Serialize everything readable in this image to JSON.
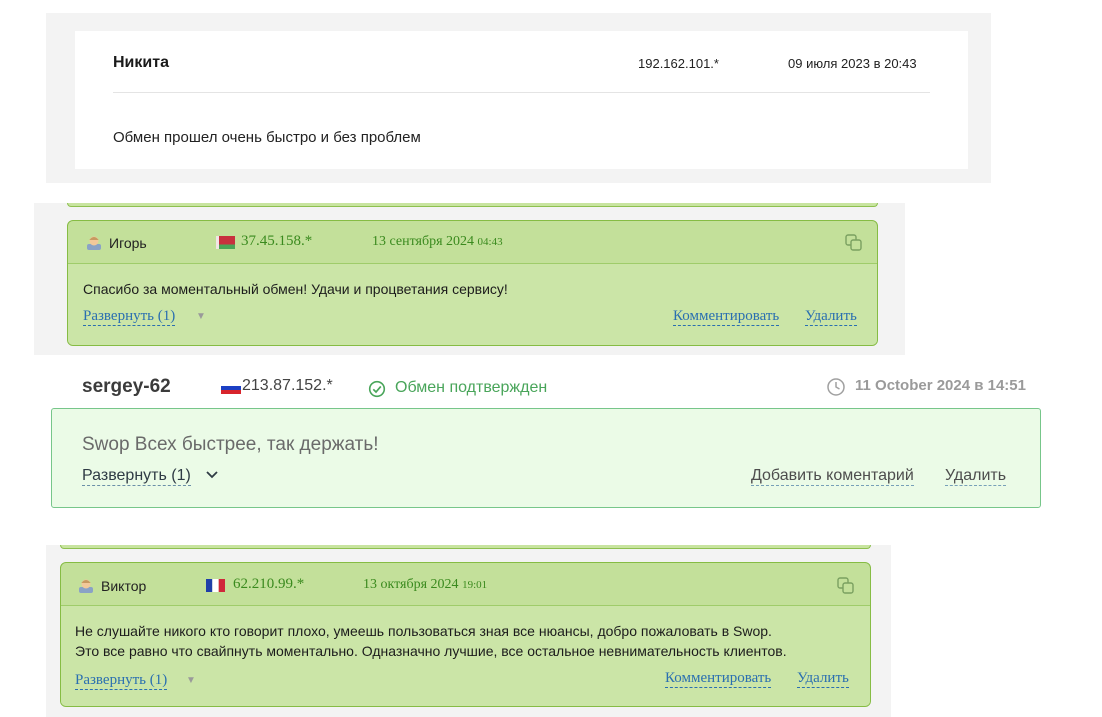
{
  "review1": {
    "name": "Никита",
    "ip": "192.162.101.*",
    "date": "09 июля 2023 в 20:43",
    "text": "Обмен прошел очень быстро и без проблем"
  },
  "review2": {
    "name": "Игорь",
    "flag": "belarus-flag",
    "ip": "37.45.158.*",
    "date": "13 сентября 2024",
    "time": "04:43",
    "text": "Спасибо за моментальный обмен! Удачи и процветания сервису!",
    "expand_label": "Развернуть (1)",
    "comment_label": "Комментировать",
    "delete_label": "Удалить"
  },
  "review3": {
    "name": "sergey-62",
    "flag": "russia-flag",
    "ip": "213.87.152.*",
    "status": "Обмен подтвержден",
    "date": "11 October 2024 в 14:51",
    "text": "Swop Всех быстрее, так держать!",
    "expand_label": "Развернуть (1)",
    "add_comment_label": "Добавить коментарий",
    "delete_label": "Удалить"
  },
  "review4": {
    "name": "Виктор",
    "flag": "france-flag",
    "ip": "62.210.99.*",
    "date": "13 октября 2024",
    "time": "19:01",
    "text_line1": "Не слушайте никого кто говорит плохо, умеешь пользоваться зная все нюансы, добро пожаловать в Swop.",
    "text_line2": "Это все равно что свайпнуть моментально. Одназначно лучшие, все остальное невнимательность клиентов.",
    "expand_label": "Развернуть (1)",
    "comment_label": "Комментировать",
    "delete_label": "Удалить"
  },
  "colors": {
    "green_header": "#c3e09a",
    "green_link": "#3a8a1e",
    "link_blue": "#2a6fb0",
    "confirmed_green": "#49a55a",
    "light_green_box": "#ebfbe7"
  }
}
